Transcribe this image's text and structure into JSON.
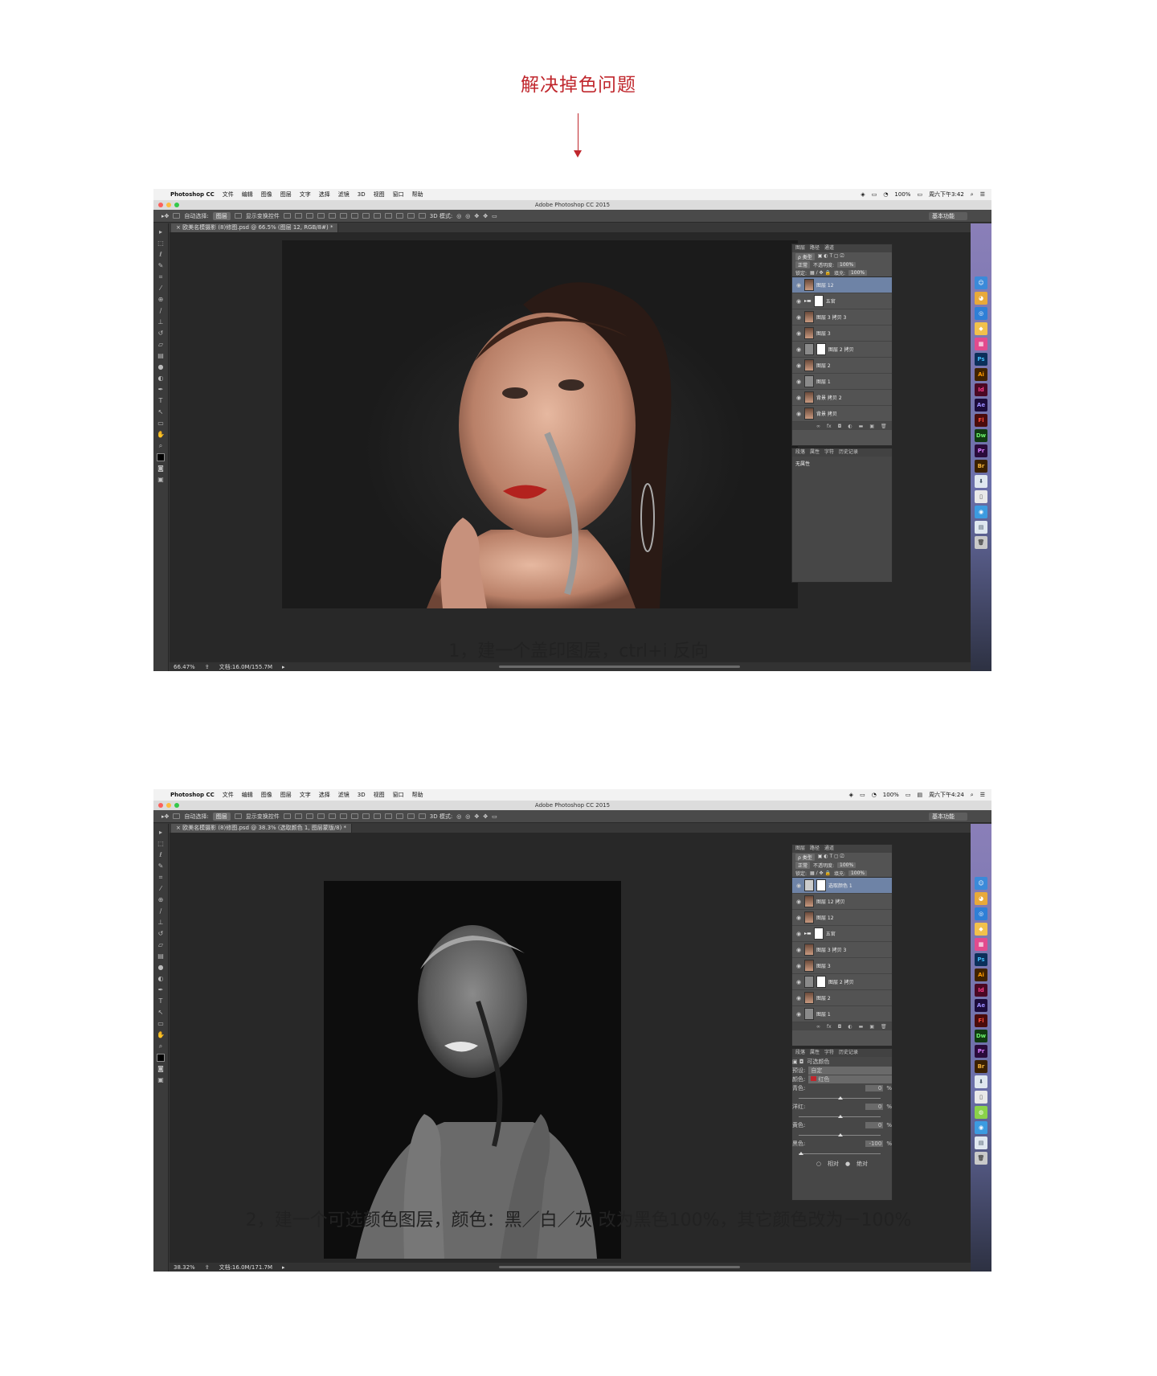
{
  "heading": "解决掉色问题",
  "captions": {
    "step1": "1，建一个盖印图层，ctrl+i 反向",
    "step2": "2，建一个可选颜色图层，颜色：黑／白／灰  改为黑色100%，其它颜色改为－100%"
  },
  "menubar": {
    "app": "Photoshop CC",
    "items": [
      "文件",
      "编辑",
      "图像",
      "图层",
      "文字",
      "选择",
      "滤镜",
      "3D",
      "视图",
      "窗口",
      "帮助"
    ],
    "battery": "100%"
  },
  "window_title": "Adobe Photoshop CC 2015",
  "options_bar": {
    "auto_select": "自动选择:",
    "auto_select_value": "图层",
    "show_transform": "显示变换控件",
    "mode_3d": "3D 模式:",
    "workspace": "基本功能"
  },
  "panels": {
    "top_tabs": [
      "图层",
      "路径",
      "通道"
    ],
    "kind_filter": "ρ 类型",
    "blend_mode": "正常",
    "opacity_label": "不透明度:",
    "opacity_value": "100%",
    "lock_label": "锁定:",
    "fill_label": "填充:",
    "fill_value": "100%",
    "bottom_tabs": [
      "段落",
      "属性",
      "字符",
      "历史记录"
    ]
  },
  "shot1": {
    "clock": "周六下午3:42",
    "doc_tab": "× 欧美名模摄影 (8)修图.psd @ 66.5% (图层 12, RGB/8#) *",
    "zoom": "66.47%",
    "doc_size": "文档:16.0M/155.7M",
    "layers": [
      "图层 12",
      "五官",
      "图层 3 拷贝 3",
      "图层 3",
      "图层 2 拷贝",
      "图层 2",
      "图层 1",
      "背景 拷贝 2",
      "背景 拷贝"
    ],
    "properties_text": "无属性"
  },
  "shot2": {
    "clock": "周六下午4:24",
    "doc_tab": "× 欧美名模摄影 (8)修图.psd @ 38.3% (选取颜色 1, 图层蒙版/8) *",
    "zoom": "38.32%",
    "doc_size": "文档:16.0M/171.7M",
    "layers": [
      "选取颜色 1",
      "图层 12 拷贝",
      "图层 12",
      "五官",
      "图层 3 拷贝 3",
      "图层 3",
      "图层 2 拷贝",
      "图层 2",
      "图层 1"
    ],
    "properties": {
      "title": "可选颜色",
      "preset_label": "预设:",
      "preset_value": "自定",
      "colors_label": "颜色:",
      "colors_value": "红色",
      "sliders": [
        {
          "label": "青色:",
          "value": "0",
          "unit": "%"
        },
        {
          "label": "洋红:",
          "value": "0",
          "unit": "%"
        },
        {
          "label": "黄色:",
          "value": "0",
          "unit": "%"
        },
        {
          "label": "黑色:",
          "value": "-100",
          "unit": "%"
        }
      ],
      "relative": "相对",
      "absolute": "绝对"
    }
  },
  "dock_icons": [
    "Ps",
    "Ai",
    "Id",
    "Ae",
    "Fl",
    "Dw",
    "Pr",
    "Br"
  ],
  "colors": {
    "accent_red": "#c0272d",
    "layer_selected": "#6e83a6"
  }
}
